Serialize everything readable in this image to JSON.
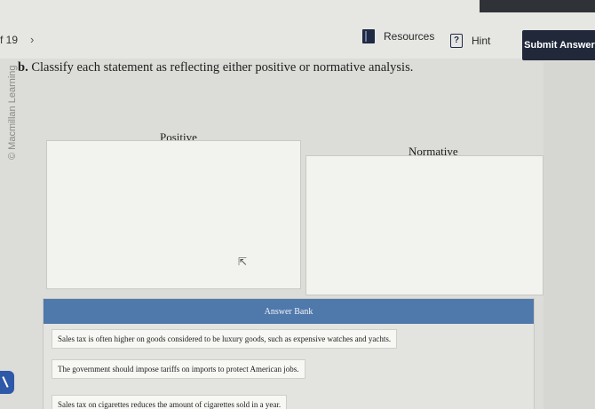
{
  "nav": {
    "question_counter": "f 19",
    "next_chevron": "›",
    "resources_label": "Resources",
    "hint_label": "Hint",
    "submit_label": "Submit Answer"
  },
  "sidebar": {
    "copyright": "© Macmillan Learning"
  },
  "question": {
    "part": "b.",
    "prompt": "Classify each statement as reflecting either positive or normative analysis."
  },
  "zones": {
    "positive_label": "Positive",
    "normative_label": "Normative"
  },
  "answer_bank": {
    "header": "Answer Bank",
    "items": [
      "Sales tax is often higher on goods considered to be luxury goods, such as expensive watches and yachts.",
      "The government should impose tariffs on imports to protect American jobs.",
      "Sales tax on cigarettes reduces the amount of cigarettes sold in a year."
    ]
  },
  "colors": {
    "submit_bg": "#20283a",
    "bank_header": "#4f78ab",
    "handle": "#2e58a8"
  }
}
